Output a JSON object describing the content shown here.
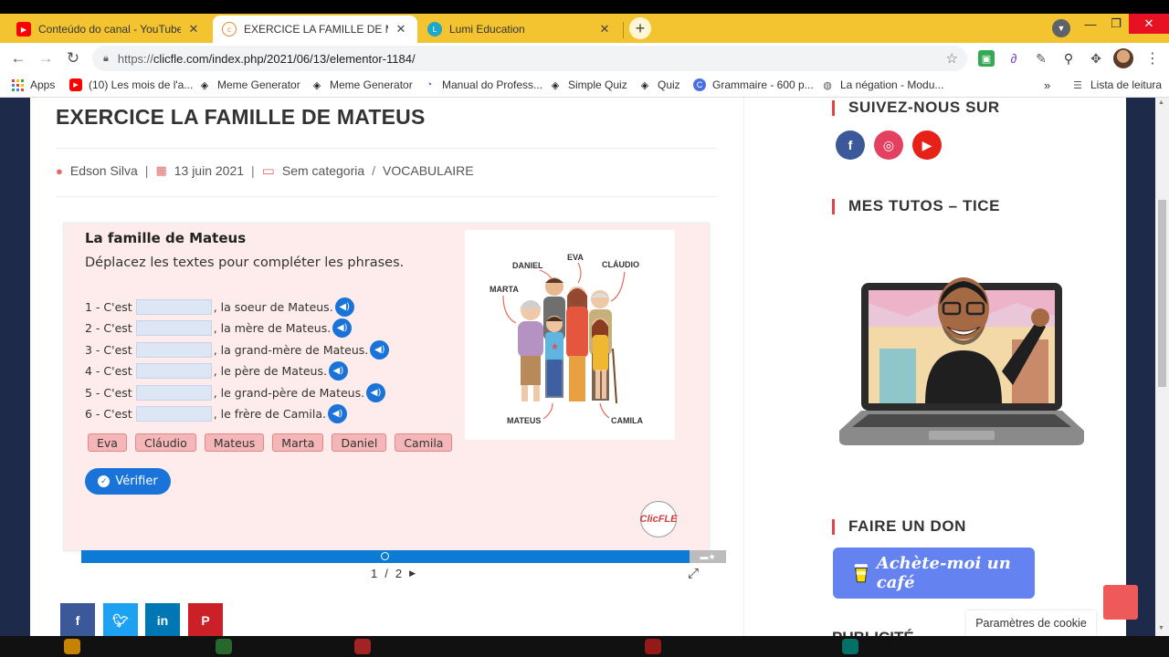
{
  "tabs": [
    {
      "title": "Conteúdo do canal - YouTube Studio",
      "favicon_color": "#ff0000"
    },
    {
      "title": "EXERCICE LA FAMILLE DE MATEUS",
      "favicon_color": "#e08a2c"
    },
    {
      "title": "Lumi Education",
      "favicon_color": "#1ea7c9"
    }
  ],
  "url": {
    "scheme": "https://",
    "rest": "clicfle.com/index.php/2021/06/13/elementor-1184/"
  },
  "bookmarks": {
    "apps": "Apps",
    "items": [
      "(10) Les mois de l'a...",
      "Meme Generator",
      "Meme Generator",
      "Manual do Profess...",
      "Simple Quiz",
      "Quiz",
      "Grammaire - 600 p...",
      "La négation - Modu..."
    ],
    "reading_list": "Lista de leitura"
  },
  "post": {
    "title": "EXERCICE LA FAMILLE DE MATEUS",
    "author": "Edson Silva",
    "date": "13 juin 2021",
    "category1": "Sem categoria",
    "category2": "VOCABULAIRE"
  },
  "exercise": {
    "title": "La famille de Mateus",
    "instruction": "Déplacez les textes pour compléter les phrases.",
    "sentences": [
      {
        "prefix": "1 - C'est",
        "suffix": ", la soeur de Mateus."
      },
      {
        "prefix": "2 - C'est",
        "suffix": ", la mère de Mateus."
      },
      {
        "prefix": "3 - C'est",
        "suffix": ", la grand-mère de Mateus."
      },
      {
        "prefix": "4 - C'est",
        "suffix": ", le père de Mateus."
      },
      {
        "prefix": "5 - C'est",
        "suffix": ", le grand-père de Mateus."
      },
      {
        "prefix": "6 - C'est",
        "suffix": ", le frère de Camila."
      }
    ],
    "words": [
      "Eva",
      "Cláudio",
      "Mateus",
      "Marta",
      "Daniel",
      "Camila"
    ],
    "check_label": "Vérifier",
    "image_labels": {
      "daniel": "DANIEL",
      "eva": "EVA",
      "claudio": "CLÁUDIO",
      "marta": "MARTA",
      "mateus": "MATEUS",
      "camila": "CAMILA"
    },
    "logo_text": "ClicFLE",
    "pager": {
      "current": "1",
      "sep": "/",
      "total": "2"
    }
  },
  "sidebar": {
    "follow_heading": "SUIVEZ-NOUS SUR",
    "tutos_heading": "MES TUTOS – TICE",
    "donate_heading": "FAIRE UN DON",
    "coffee_label": "Achète-moi un café",
    "cut_heading": "PUBLICITÉ"
  },
  "cookie_label": "Paramètres de cookie",
  "colors": {
    "accent_blue": "#1a73d9",
    "accent_red": "#e04444",
    "tab_bar": "#f4c430"
  }
}
